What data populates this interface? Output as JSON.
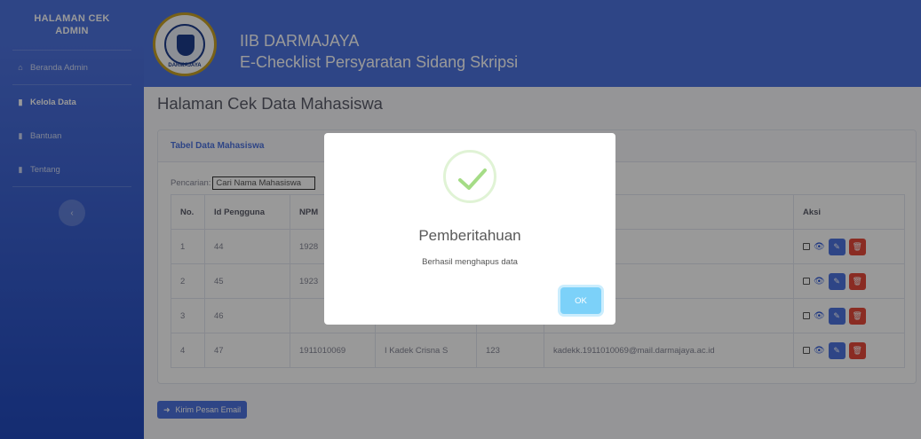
{
  "sidebar": {
    "brand": "HALAMAN CEK ADMIN",
    "items": [
      {
        "label": "Beranda Admin",
        "icon": "home-icon"
      },
      {
        "label": "Kelola Data",
        "icon": "file-icon"
      },
      {
        "label": "Bantuan",
        "icon": "file-icon"
      },
      {
        "label": "Tentang",
        "icon": "file-icon"
      }
    ],
    "toggle_icon": "chevron-left-icon"
  },
  "topbar": {
    "line1": "IIB DARMAJAYA",
    "line2": "E-Checklist Persyaratan Sidang Skripsi",
    "logo_text": "DARMAJAYA"
  },
  "page": {
    "title": "Halaman Cek Data Mahasiswa"
  },
  "card": {
    "header": "Tabel Data Mahasiswa",
    "search_label": "Pencarian:",
    "search_placeholder": "Cari Nama Mahasiswa",
    "columns": [
      "No.",
      "Id Pengguna",
      "NPM",
      "",
      "",
      "asiswa",
      "Aksi"
    ],
    "rows": [
      {
        "no": "1",
        "id": "44",
        "npm": "1928",
        "nama": "",
        "pass": "",
        "email": "@gmail.com"
      },
      {
        "no": "2",
        "id": "45",
        "npm": "1923",
        "nama": "",
        "pass": "",
        "email": "ail.com"
      },
      {
        "no": "3",
        "id": "46",
        "npm": "",
        "nama": "",
        "pass": "",
        "email": ""
      },
      {
        "no": "4",
        "id": "47",
        "npm": "1911010069",
        "nama": "I Kadek Crisna S",
        "pass": "123",
        "email": "kadekk.1911010069@mail.darmajaya.ac.id"
      }
    ]
  },
  "email_button": "Kirim Pesan Email",
  "modal": {
    "title": "Pemberitahuan",
    "text": "Berhasil menghapus data",
    "ok": "OK"
  },
  "colors": {
    "primary": "#4e73df",
    "danger": "#e74a3b",
    "success": "#a5dc86",
    "ok_button": "#7cd1f9"
  }
}
